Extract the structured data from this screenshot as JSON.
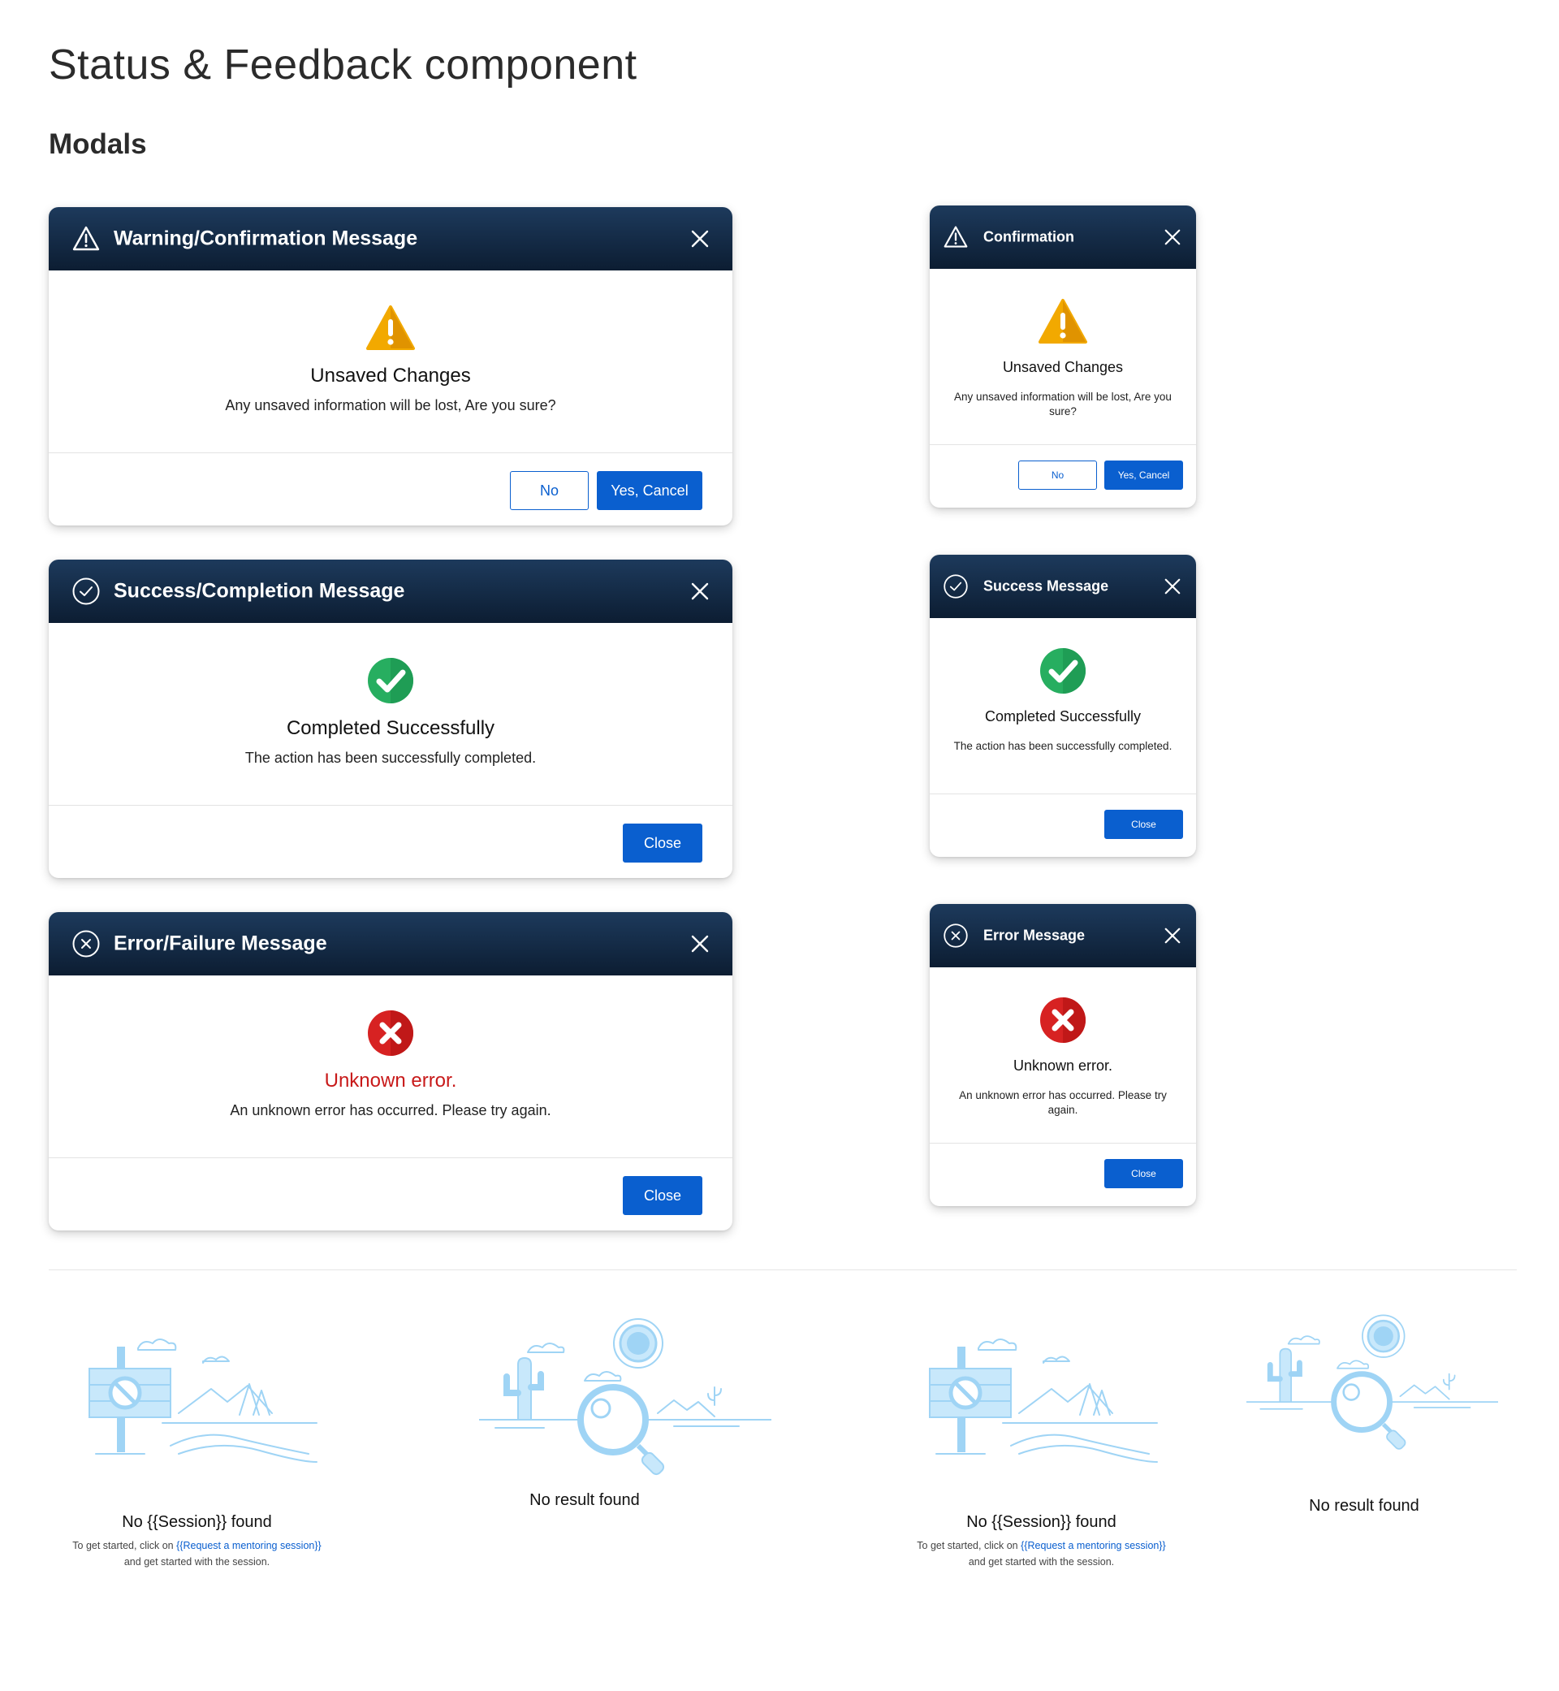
{
  "page": {
    "title": "Status & Feedback component",
    "section": "Modals"
  },
  "colors": {
    "header_gradient_top": "#1d3a5c",
    "header_gradient_bottom": "#0c1d32",
    "primary": "#0a5fcf",
    "warning": "#f0a500",
    "success": "#27ae60",
    "error": "#d32020",
    "illustration": "#9fd4f5"
  },
  "large_modals": [
    {
      "header_icon": "warning-triangle-icon",
      "header_title": "Warning/Confirmation Message",
      "body_icon": "warning-icon",
      "heading": "Unsaved Changes",
      "message": "Any unsaved information will be lost, Are you sure?",
      "secondary_button": "No",
      "primary_button": "Yes, Cancel"
    },
    {
      "header_icon": "check-circle-icon",
      "header_title": "Success/Completion Message",
      "body_icon": "success-check-icon",
      "heading": "Completed Successfully",
      "message": "The action has been successfully completed.",
      "primary_button": "Close"
    },
    {
      "header_icon": "x-circle-icon",
      "header_title": "Error/Failure Message",
      "body_icon": "error-x-icon",
      "heading": "Unknown error.",
      "message": "An unknown error has occurred. Please try again.",
      "primary_button": "Close"
    }
  ],
  "small_modals": [
    {
      "header_icon": "warning-triangle-icon",
      "header_title": "Confirmation",
      "body_icon": "warning-icon",
      "heading": "Unsaved Changes",
      "message": "Any unsaved information will be lost, Are you sure?",
      "secondary_button": "No",
      "primary_button": "Yes, Cancel"
    },
    {
      "header_icon": "check-circle-icon",
      "header_title": "Success Message",
      "body_icon": "success-check-icon",
      "heading": "Completed Successfully",
      "message": "The action has been successfully completed.",
      "primary_button": "Close"
    },
    {
      "header_icon": "x-circle-icon",
      "header_title": "Error Message",
      "body_icon": "error-x-icon",
      "heading": "Unknown error.",
      "message": "An unknown error has occurred. Please try again.",
      "primary_button": "Close"
    }
  ],
  "empty_states": [
    {
      "illustration": "signpost-no-entry-illustration",
      "title": "No {{Session}} found",
      "subtitle_prefix": "To get started, click on ",
      "subtitle_link": "{{Request a mentoring session}}",
      "subtitle_suffix": "and get started with the session."
    },
    {
      "illustration": "desert-magnifier-illustration",
      "title": "No result found"
    },
    {
      "illustration": "signpost-no-entry-illustration",
      "title": "No {{Session}} found",
      "subtitle_prefix": "To get started, click on ",
      "subtitle_link": "{{Request a mentoring session}}",
      "subtitle_suffix": "and get started with the session."
    },
    {
      "illustration": "desert-magnifier-illustration",
      "title": "No result found"
    }
  ]
}
